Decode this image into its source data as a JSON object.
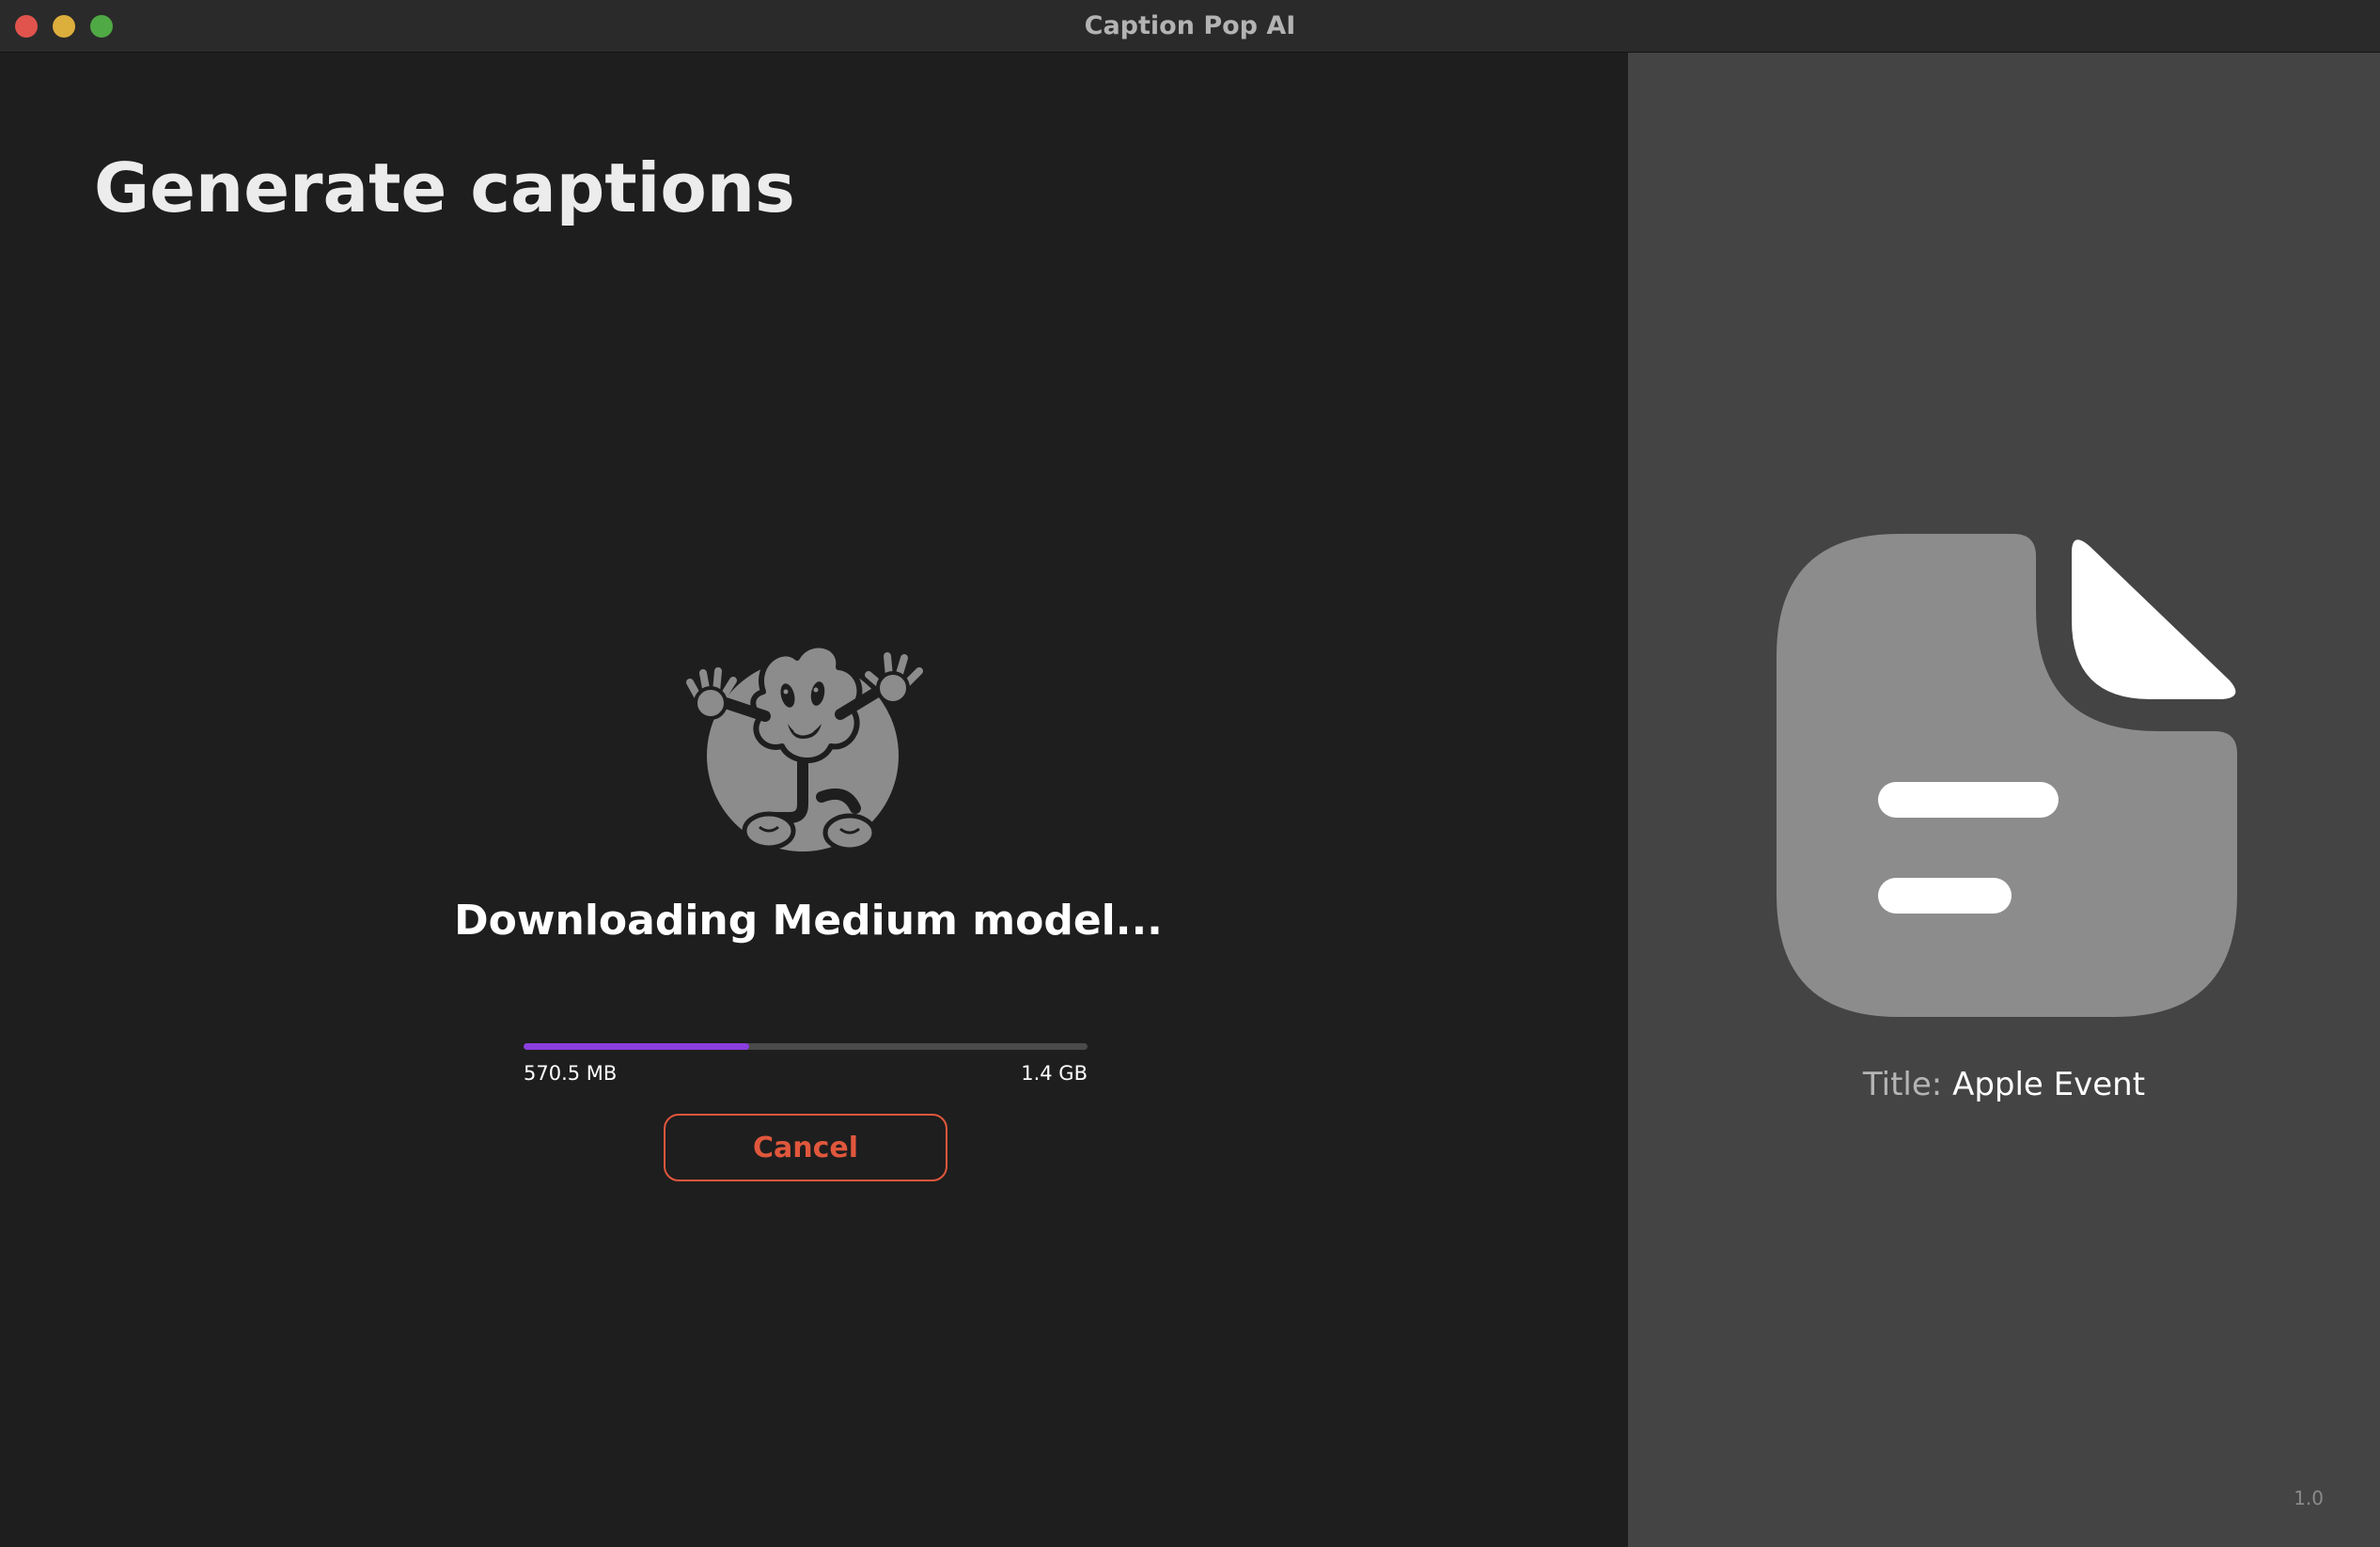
{
  "window": {
    "title": "Caption Pop AI"
  },
  "main": {
    "heading": "Generate captions",
    "status": "Downloading Medium model...",
    "progress": {
      "fraction": 0.4,
      "downloaded": "570.5 MB",
      "total": "1.4 GB"
    },
    "cancel_label": "Cancel"
  },
  "sidebar": {
    "title_label": "Title:",
    "title_value": "Apple Event",
    "version": "1.0"
  },
  "icons": {
    "mascot": "popcorn-mascot-icon",
    "document": "document-icon"
  },
  "colors": {
    "accent": "#8b3ee0",
    "cancel": "#e0573c",
    "panel": "#444444",
    "background": "#1e1e1e"
  }
}
